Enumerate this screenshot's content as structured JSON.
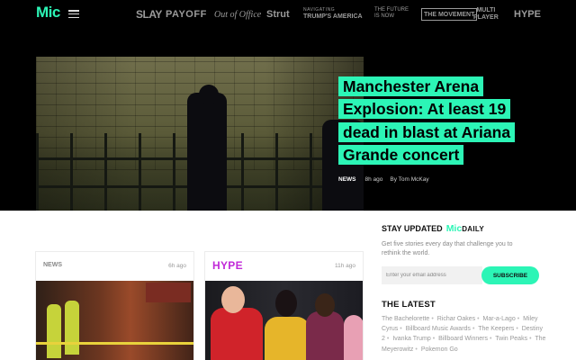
{
  "header": {
    "logo": "Mic",
    "nav": [
      {
        "label": "SLAY"
      },
      {
        "label": "PAYOFF"
      },
      {
        "label": "Out of Office"
      },
      {
        "label": "Strut"
      },
      {
        "line1": "NAVIGATING",
        "line2": "TRUMP'S AMERICA"
      },
      {
        "line1": "THE FUTURE",
        "line2": "IS NOW"
      },
      {
        "label": "THE MOVEMENT"
      },
      {
        "line1": "MULTI",
        "line2": "PLAYER"
      },
      {
        "label": "HYPE"
      }
    ]
  },
  "hero": {
    "headline": "Manchester Arena Explosion: At least 19 dead in blast at Ariana Grande concert",
    "category": "NEWS",
    "age": "8h ago",
    "byline": "By Tom McKay"
  },
  "cards": [
    {
      "category": "NEWS",
      "age": "6h ago"
    },
    {
      "category": "HYPE",
      "age": "11h ago"
    }
  ],
  "newsletter": {
    "title": "STAY UPDATED",
    "brand": "Mic",
    "brand_suffix": "DAILY",
    "description": "Get five stories every day that challenge you to rethink the world.",
    "email_placeholder": "Enter your email address",
    "button": "SUBSCRIBE"
  },
  "latest": {
    "title": "THE LATEST",
    "links": [
      "The Bachelorette",
      "Richar Oakes",
      "Mar-a-Lago",
      "Miley Cyrus",
      "Billboard Music Awards",
      "The Keepers",
      "Destiny 2",
      "Ivanka Trump",
      "Billboard Winners",
      "Twin Peaks",
      "The Meyerowitz",
      "Pokemon Go"
    ]
  },
  "colors": {
    "accent": "#2cf5b6",
    "hype": "#c12ad8",
    "background": "#000000"
  }
}
